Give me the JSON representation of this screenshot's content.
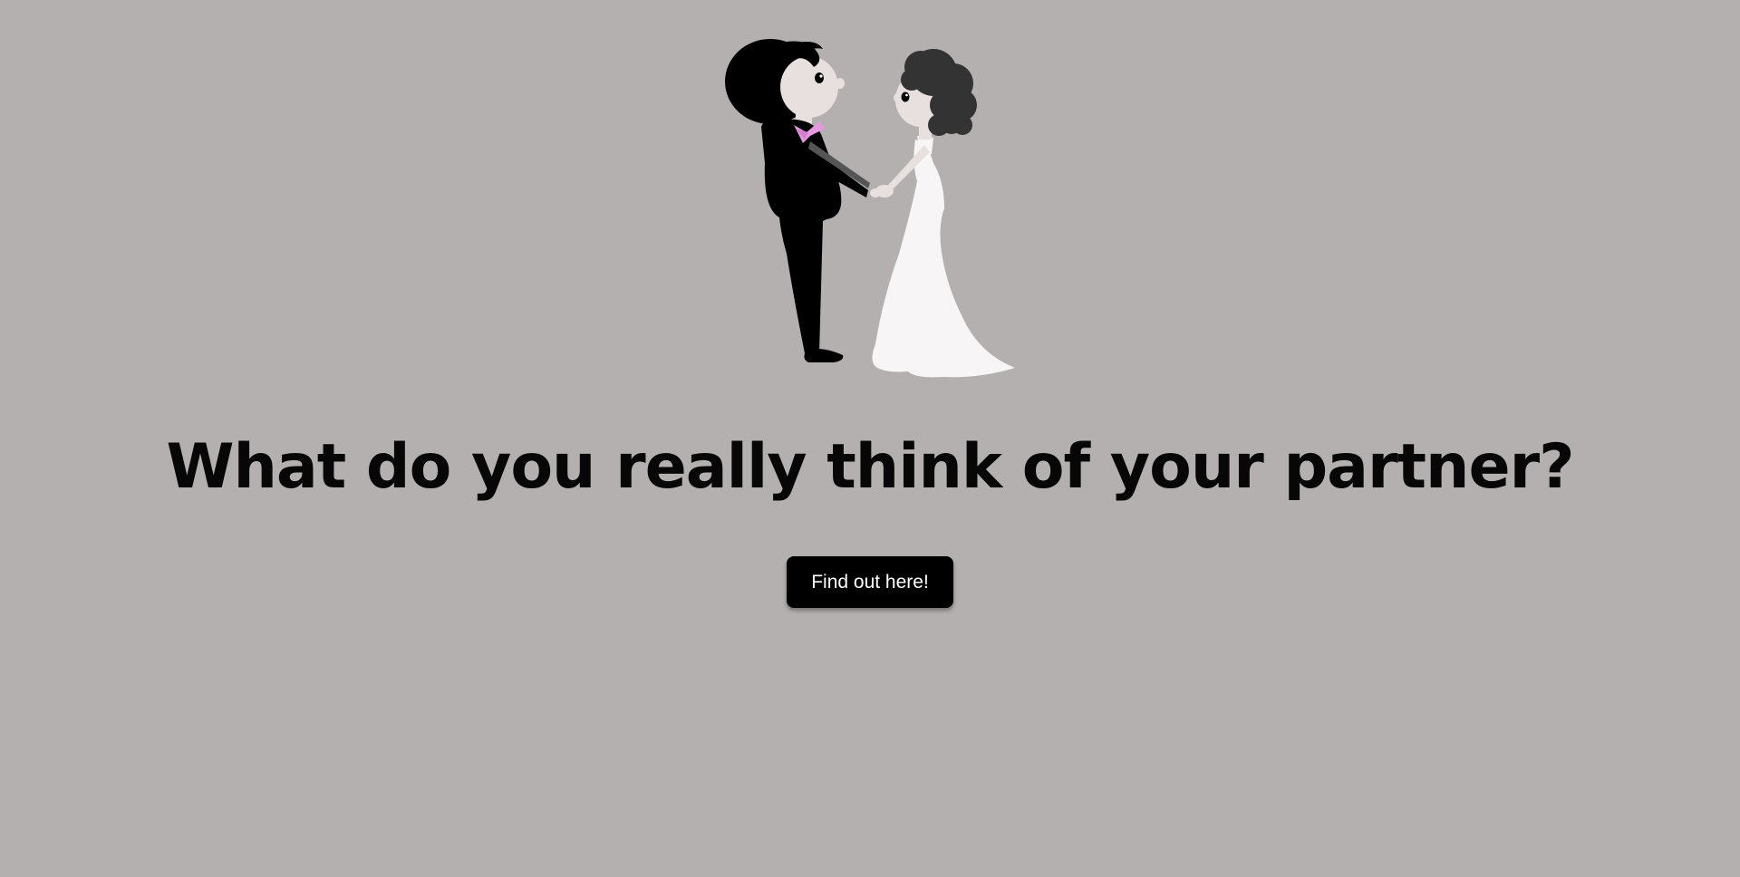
{
  "hero": {
    "headline": "What do you really think of your partner?",
    "cta_label": "Find out here!"
  },
  "colors": {
    "background": "#b3b0af",
    "text": "#070707",
    "button_bg": "#000000",
    "button_text": "#ffffff",
    "bow_tie": "#e59ae0",
    "skin": "#e8dfdf",
    "dress": "#f7f5f5",
    "bride_hair": "#333333"
  },
  "illustration": {
    "icon": "wedding-couple-icon"
  }
}
